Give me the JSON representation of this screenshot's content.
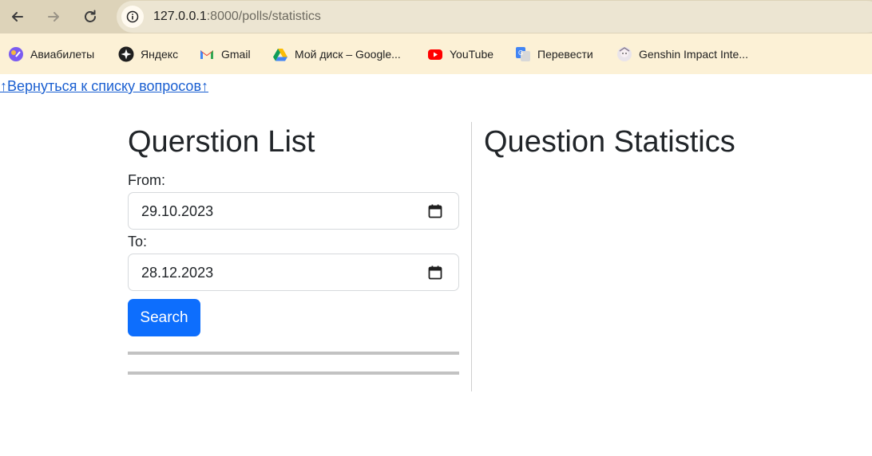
{
  "browser": {
    "url_host": "127.0.0.1",
    "url_rest": ":8000/polls/statistics"
  },
  "bookmarks": [
    {
      "label": "Авиабилеты",
      "icon": "aviatickets-icon"
    },
    {
      "label": "Яндекс",
      "icon": "yandex-icon"
    },
    {
      "label": "Gmail",
      "icon": "gmail-icon"
    },
    {
      "label": "Мой диск – Google...",
      "icon": "google-drive-icon"
    },
    {
      "label": "YouTube",
      "icon": "youtube-icon"
    },
    {
      "label": "Перевести",
      "icon": "google-translate-icon"
    },
    {
      "label": "Genshin Impact Inte...",
      "icon": "genshin-icon"
    }
  ],
  "page": {
    "back_link": "↑Вернуться к списку вопросов↑",
    "left_title": "Querstion List",
    "from_label": "From:",
    "from_value": "29.10.2023",
    "to_label": "To:",
    "to_value": "28.12.2023",
    "search_label": "Search",
    "right_title": "Question Statistics"
  },
  "colors": {
    "toolbar": "#ddd3b9",
    "bookmarks_bar": "#fcf1d6",
    "primary_button": "#0d6efd",
    "link": "#1a5fd1"
  }
}
